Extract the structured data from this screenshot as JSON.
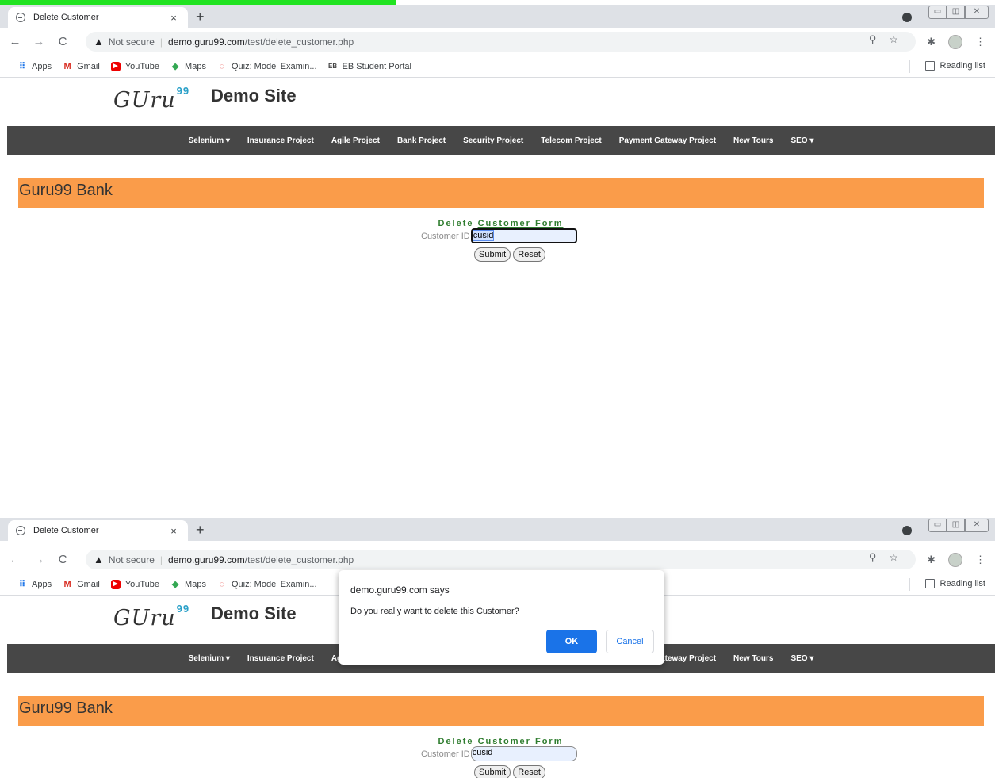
{
  "browser": {
    "tab_title": "Delete Customer",
    "tab_close": "×",
    "new_tab": "+",
    "not_secure": "Not secure",
    "url_host": "demo.guru99.com",
    "url_path": "/test/delete_customer.php",
    "bookmarks": [
      "Apps",
      "Gmail",
      "YouTube",
      "Maps",
      "Quiz: Model Examin...",
      "EB Student Portal"
    ],
    "reading_list": "Reading list"
  },
  "site": {
    "logo": "GUru",
    "logo_sup": "99",
    "name": "Demo Site",
    "menu": [
      "Selenium ▾",
      "Insurance Project",
      "Agile Project",
      "Bank Project",
      "Security Project",
      "Telecom Project",
      "Payment Gateway Project",
      "New Tours",
      "SEO ▾"
    ],
    "bank_title": "Guru99 Bank"
  },
  "form": {
    "title_part1": "Delete ",
    "title_part2": "Customer Form",
    "customer_id_label": "Customer ID",
    "customer_id_value": "cusid",
    "submit": "Submit",
    "reset": "Reset"
  },
  "dialog": {
    "title": "demo.guru99.com says",
    "message": "Do you really want to delete this Customer?",
    "ok": "OK",
    "cancel": "Cancel"
  },
  "colors": {
    "accent_bar": "#fa9c4a",
    "menu_bg": "#474747",
    "form_title": "#2f7d2f",
    "dialog_ok": "#1a73e8"
  }
}
